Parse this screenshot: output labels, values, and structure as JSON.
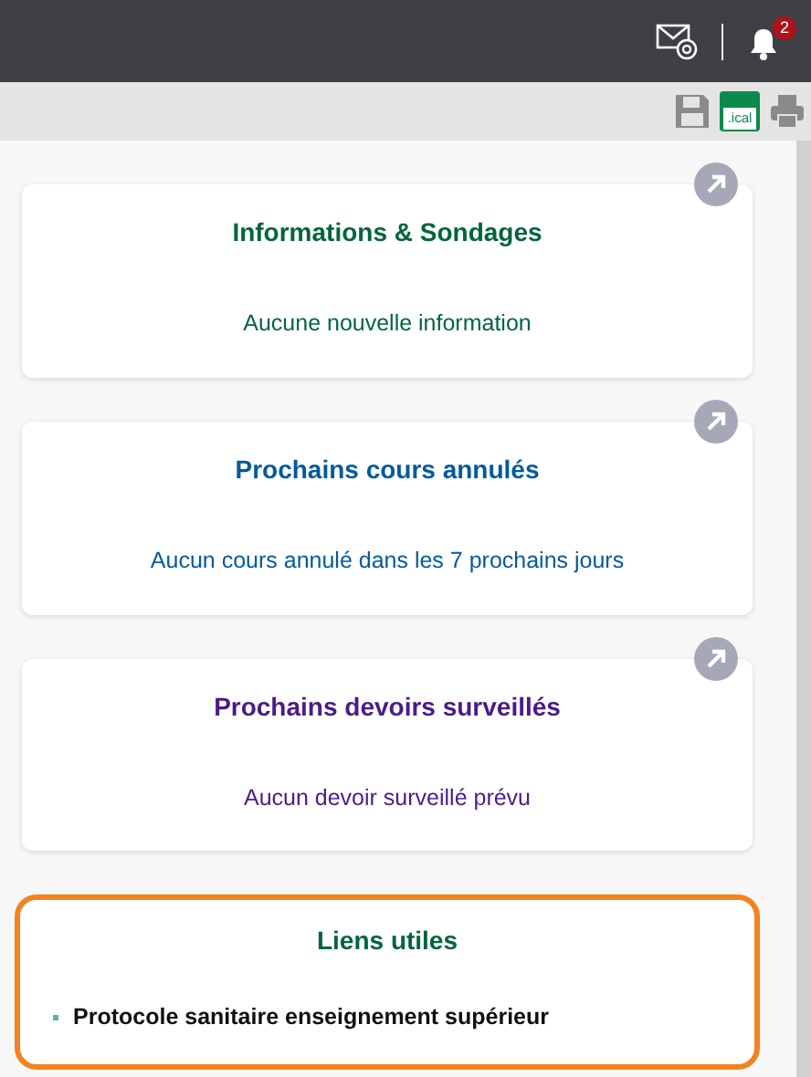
{
  "header": {
    "notification_count": "2"
  },
  "toolbar": {
    "ical_label": ".ical"
  },
  "cards": [
    {
      "kind": "message",
      "title": "Informations & Sondages",
      "message": "Aucune nouvelle information",
      "color": "#00663a",
      "selected": false
    },
    {
      "kind": "message",
      "title": "Prochains cours annulés",
      "message": "Aucun cours annulé dans les 7 prochains jours",
      "color": "#005a9e",
      "selected": false
    },
    {
      "kind": "message",
      "title": "Prochains devoirs surveillés",
      "message": "Aucun devoir surveillé prévu",
      "color": "#4b1a8a",
      "selected": false
    },
    {
      "kind": "links",
      "title": "Liens utiles",
      "links": [
        "Protocole sanitaire enseignement supérieur"
      ],
      "color": "#00663a",
      "selected": true
    }
  ]
}
